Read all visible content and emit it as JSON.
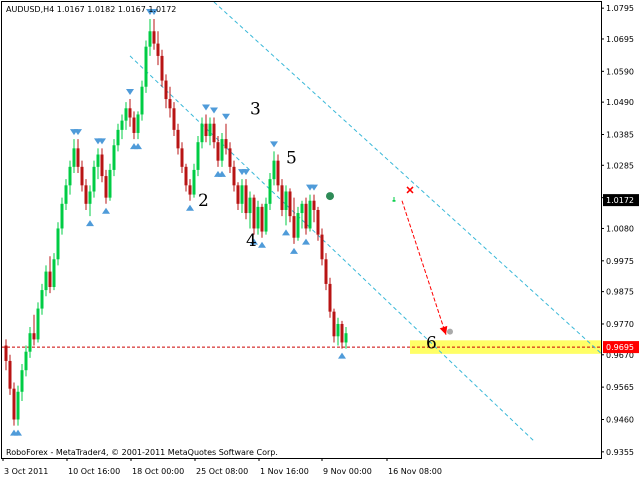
{
  "header": {
    "symbol_line": "AUDUSD,H4  1.0167 1.0182 1.0167 1.0172"
  },
  "footer": {
    "copyright": "RoboForex - MetaTrader4, © 2001-2011 MetaQuotes Software Corp."
  },
  "colors": {
    "background": "#ffffff",
    "frame": "#000000",
    "bull_bar": "#00cc44",
    "bear_bar": "#b81414",
    "channel": "#39b8d8",
    "fractal": "#4f9bd9",
    "support_zone": "#ffff66",
    "price_line": "#cc0000",
    "forecast_arrow": "#ff0000",
    "price_tag_current": "#000000",
    "price_tag_target": "#ff0000",
    "current_tag_text": "#ffffff"
  },
  "icons": [
    "fractal-arrow-icon",
    "close-cross-icon",
    "position-marker-icon"
  ],
  "chart_data": {
    "type": "candlestick",
    "instrument": "AUDUSD",
    "timeframe": "H4",
    "ohlc_current": {
      "open": 1.0167,
      "high": 1.0182,
      "low": 1.0167,
      "close": 1.0172
    },
    "ylim": [
      0.9335,
      1.0815
    ],
    "grid": false,
    "y_ticks": [
      "1.0795",
      "1.0695",
      "1.0590",
      "1.0490",
      "1.0385",
      "1.0285",
      "1.0180",
      "1.0080",
      "0.9975",
      "0.9875",
      "0.9770",
      "0.9670",
      "0.9565",
      "0.9460",
      "0.9355"
    ],
    "x_ticks": [
      "3 Oct 2011",
      "10 Oct 16:00",
      "18 Oct 00:00",
      "25 Oct 08:00",
      "1 Nov 16:00",
      "9 Nov 00:00",
      "16 Nov 08:00"
    ],
    "price_tags": [
      {
        "label": "1.0172",
        "value": 1.0172,
        "kind": "current"
      },
      {
        "label": "0.9695",
        "value": 0.9695,
        "kind": "target"
      }
    ],
    "target_level": 0.9695,
    "wave_labels": [
      {
        "label": "2",
        "bar": 46,
        "price": 1.0172
      },
      {
        "label": "3",
        "bar": 59,
        "price": 1.047
      },
      {
        "label": "4",
        "bar": 58,
        "price": 1.0042
      },
      {
        "label": "5",
        "bar": 68,
        "price": 1.031
      },
      {
        "label": "6",
        "bar": 103,
        "price": 0.971
      }
    ],
    "bars": [
      [
        0.97,
        0.972,
        0.962,
        0.965
      ],
      [
        0.965,
        0.967,
        0.954,
        0.956
      ],
      [
        0.956,
        0.958,
        0.944,
        0.946
      ],
      [
        0.946,
        0.957,
        0.944,
        0.955
      ],
      [
        0.955,
        0.964,
        0.952,
        0.962
      ],
      [
        0.962,
        0.97,
        0.96,
        0.968
      ],
      [
        0.968,
        0.976,
        0.966,
        0.974
      ],
      [
        0.974,
        0.98,
        0.97,
        0.972
      ],
      [
        0.972,
        0.984,
        0.971,
        0.982
      ],
      [
        0.982,
        0.99,
        0.98,
        0.988
      ],
      [
        0.988,
        0.996,
        0.986,
        0.994
      ],
      [
        0.994,
        0.999,
        0.987,
        0.989
      ],
      [
        0.989,
        1.0,
        0.988,
        0.998
      ],
      [
        0.998,
        1.01,
        0.996,
        1.008
      ],
      [
        1.008,
        1.018,
        1.006,
        1.016
      ],
      [
        1.016,
        1.024,
        1.014,
        1.022
      ],
      [
        1.022,
        1.03,
        1.019,
        1.028
      ],
      [
        1.028,
        1.037,
        1.026,
        1.034
      ],
      [
        1.034,
        1.037,
        1.026,
        1.028
      ],
      [
        1.028,
        1.03,
        1.02,
        1.022
      ],
      [
        1.022,
        1.024,
        1.014,
        1.016
      ],
      [
        1.016,
        1.022,
        1.012,
        1.02
      ],
      [
        1.02,
        1.03,
        1.018,
        1.028
      ],
      [
        1.028,
        1.034,
        1.024,
        1.032
      ],
      [
        1.032,
        1.034,
        1.023,
        1.025
      ],
      [
        1.025,
        1.027,
        1.016,
        1.018
      ],
      [
        1.018,
        1.029,
        1.017,
        1.027
      ],
      [
        1.027,
        1.037,
        1.025,
        1.035
      ],
      [
        1.035,
        1.042,
        1.033,
        1.04
      ],
      [
        1.04,
        1.045,
        1.037,
        1.043
      ],
      [
        1.043,
        1.049,
        1.04,
        1.047
      ],
      [
        1.047,
        1.05,
        1.041,
        1.044
      ],
      [
        1.044,
        1.046,
        1.037,
        1.039
      ],
      [
        1.039,
        1.046,
        1.037,
        1.045
      ],
      [
        1.045,
        1.056,
        1.043,
        1.054
      ],
      [
        1.054,
        1.069,
        1.052,
        1.067
      ],
      [
        1.067,
        1.076,
        1.064,
        1.072
      ],
      [
        1.072,
        1.076,
        1.066,
        1.068
      ],
      [
        1.068,
        1.072,
        1.061,
        1.064
      ],
      [
        1.064,
        1.066,
        1.054,
        1.056
      ],
      [
        1.056,
        1.058,
        1.047,
        1.05
      ],
      [
        1.05,
        1.054,
        1.044,
        1.047
      ],
      [
        1.047,
        1.049,
        1.038,
        1.04
      ],
      [
        1.04,
        1.042,
        1.032,
        1.034
      ],
      [
        1.034,
        1.036,
        1.026,
        1.028
      ],
      [
        1.028,
        1.029,
        1.02,
        1.022
      ],
      [
        1.022,
        1.024,
        1.017,
        1.019
      ],
      [
        1.019,
        1.029,
        1.018,
        1.027
      ],
      [
        1.027,
        1.038,
        1.025,
        1.036
      ],
      [
        1.036,
        1.044,
        1.034,
        1.042
      ],
      [
        1.042,
        1.045,
        1.036,
        1.038
      ],
      [
        1.038,
        1.044,
        1.035,
        1.042
      ],
      [
        1.042,
        1.044,
        1.034,
        1.036
      ],
      [
        1.036,
        1.038,
        1.028,
        1.03
      ],
      [
        1.03,
        1.039,
        1.028,
        1.037
      ],
      [
        1.037,
        1.042,
        1.032,
        1.034
      ],
      [
        1.034,
        1.036,
        1.026,
        1.028
      ],
      [
        1.028,
        1.03,
        1.02,
        1.022
      ],
      [
        1.022,
        1.023,
        1.014,
        1.016
      ],
      [
        1.016,
        1.024,
        1.013,
        1.022
      ],
      [
        1.022,
        1.024,
        1.011,
        1.013
      ],
      [
        1.013,
        1.02,
        1.008,
        1.018
      ],
      [
        1.018,
        1.019,
        1.006,
        1.008
      ],
      [
        1.008,
        1.017,
        1.006,
        1.015
      ],
      [
        1.015,
        1.016,
        1.005,
        1.007
      ],
      [
        1.007,
        1.018,
        1.006,
        1.016
      ],
      [
        1.016,
        1.026,
        1.014,
        1.024
      ],
      [
        1.024,
        1.033,
        1.022,
        1.03
      ],
      [
        1.03,
        1.032,
        1.02,
        1.022
      ],
      [
        1.022,
        1.024,
        1.012,
        1.014
      ],
      [
        1.014,
        1.022,
        1.009,
        1.02
      ],
      [
        1.02,
        1.021,
        1.01,
        1.012
      ],
      [
        1.012,
        1.018,
        1.003,
        1.005
      ],
      [
        1.005,
        1.015,
        1.004,
        1.013
      ],
      [
        1.013,
        1.017,
        1.008,
        1.016
      ],
      [
        1.016,
        1.018,
        1.006,
        1.008
      ],
      [
        1.008,
        1.019,
        1.007,
        1.017
      ],
      [
        1.017,
        1.019,
        1.01,
        1.014
      ],
      [
        1.014,
        1.015,
        1.004,
        1.006
      ],
      [
        1.006,
        1.008,
        0.996,
        0.998
      ],
      [
        0.998,
        1.0,
        0.988,
        0.99
      ],
      [
        0.99,
        0.992,
        0.979,
        0.981
      ],
      [
        0.981,
        0.982,
        0.971,
        0.973
      ],
      [
        0.973,
        0.979,
        0.97,
        0.977
      ],
      [
        0.977,
        0.978,
        0.969,
        0.971
      ],
      [
        0.971,
        0.976,
        0.969,
        0.974
      ],
      [
        1.0167,
        1.0182,
        1.0167,
        1.0172
      ]
    ]
  }
}
